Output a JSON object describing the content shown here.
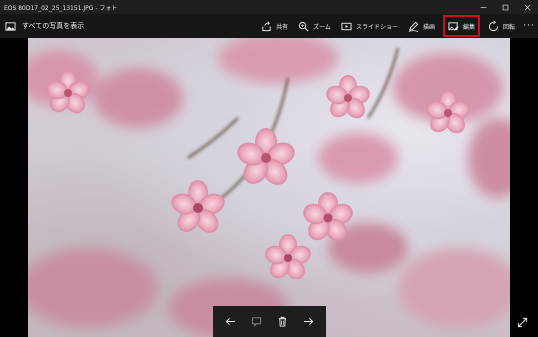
{
  "window": {
    "title": "EOS 80D17_02_25_13151.JPG - フォト",
    "controls": [
      "minimize-icon",
      "maximize-icon",
      "close-icon"
    ]
  },
  "commandbar": {
    "back_label": "すべての写真を表示",
    "share_label": "共有",
    "zoom_label": "ズーム",
    "slideshow_label": "スライドショー",
    "draw_label": "描画",
    "edit_label": "編集",
    "rotate_label": "回転",
    "more_label": "···"
  },
  "colors": {
    "highlight": "#c8101e",
    "titlebar": "#1f1f1f",
    "commandbar": "#161616"
  },
  "navbar": {
    "icons": [
      "arrow-left-icon",
      "comment-icon",
      "trash-icon",
      "arrow-right-icon"
    ]
  }
}
